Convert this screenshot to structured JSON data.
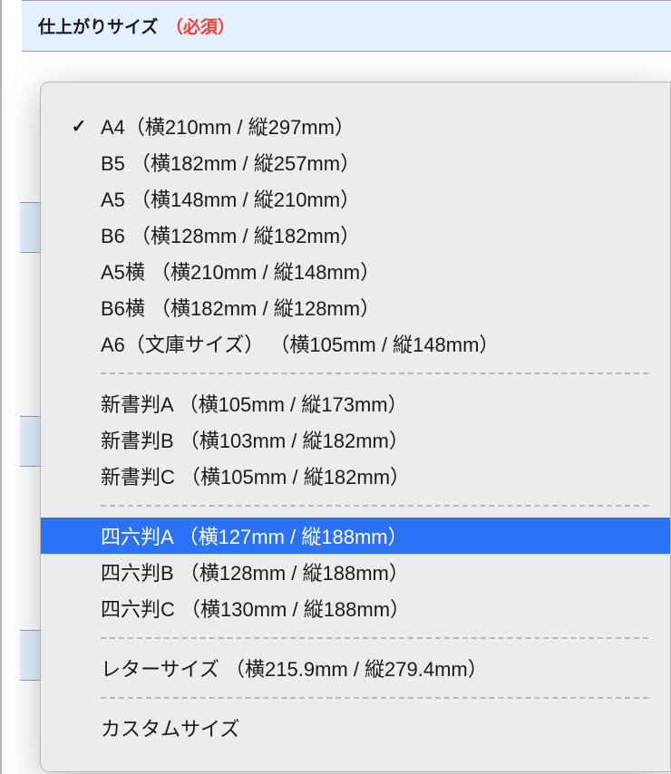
{
  "header": {
    "label": "仕上がりサイズ",
    "required": "（必須）"
  },
  "dropdown": {
    "groups": [
      {
        "items": [
          {
            "label": "A4（横210mm / 縦297mm）",
            "selected": true,
            "highlighted": false
          },
          {
            "label": "B5 （横182mm / 縦257mm）",
            "selected": false,
            "highlighted": false
          },
          {
            "label": "A5 （横148mm / 縦210mm）",
            "selected": false,
            "highlighted": false
          },
          {
            "label": "B6 （横128mm / 縦182mm）",
            "selected": false,
            "highlighted": false
          },
          {
            "label": "A5横 （横210mm / 縦148mm）",
            "selected": false,
            "highlighted": false
          },
          {
            "label": "B6横 （横182mm / 縦128mm）",
            "selected": false,
            "highlighted": false
          },
          {
            "label": "A6（文庫サイズ） （横105mm / 縦148mm）",
            "selected": false,
            "highlighted": false
          }
        ]
      },
      {
        "items": [
          {
            "label": "新書判A （横105mm / 縦173mm）",
            "selected": false,
            "highlighted": false
          },
          {
            "label": "新書判B （横103mm / 縦182mm）",
            "selected": false,
            "highlighted": false
          },
          {
            "label": "新書判C （横105mm / 縦182mm）",
            "selected": false,
            "highlighted": false
          }
        ]
      },
      {
        "items": [
          {
            "label": "四六判A （横127mm / 縦188mm）",
            "selected": false,
            "highlighted": true
          },
          {
            "label": "四六判B （横128mm / 縦188mm）",
            "selected": false,
            "highlighted": false
          },
          {
            "label": "四六判C （横130mm / 縦188mm）",
            "selected": false,
            "highlighted": false
          }
        ]
      },
      {
        "items": [
          {
            "label": "レターサイズ （横215.9mm / 縦279.4mm）",
            "selected": false,
            "highlighted": false
          }
        ]
      },
      {
        "items": [
          {
            "label": "カスタムサイズ",
            "selected": false,
            "highlighted": false
          }
        ]
      }
    ]
  }
}
